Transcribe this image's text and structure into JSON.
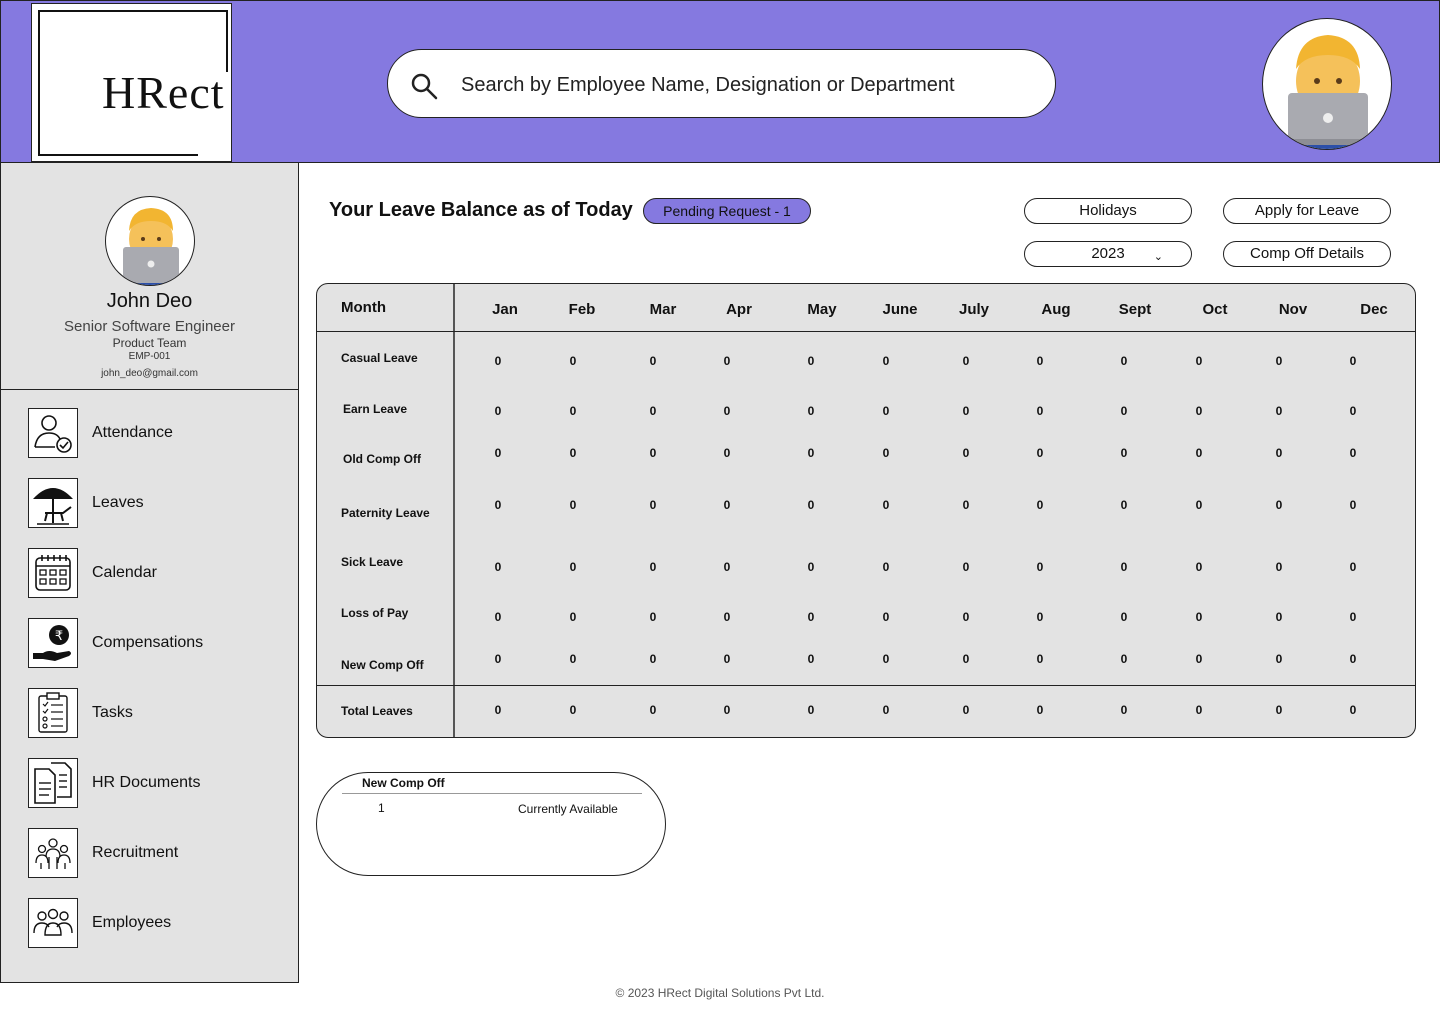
{
  "header": {
    "logo_text": "HRect",
    "search_placeholder": "Search by Employee Name, Designation or Department",
    "brand_color": "#8579e0"
  },
  "profile": {
    "name": "John Deo",
    "role": "Senior Software Engineer",
    "team": "Product Team",
    "emp_id": "EMP-001",
    "email": "john_deo@gmail.com"
  },
  "nav": [
    {
      "label": "Attendance",
      "icon": "user-check-icon"
    },
    {
      "label": "Leaves",
      "icon": "beach-umbrella-icon"
    },
    {
      "label": "Calendar",
      "icon": "calendar-icon"
    },
    {
      "label": "Compensations",
      "icon": "rupee-hand-icon"
    },
    {
      "label": "Tasks",
      "icon": "checklist-icon"
    },
    {
      "label": "HR Documents",
      "icon": "documents-icon"
    },
    {
      "label": "Recruitment",
      "icon": "recruitment-icon"
    },
    {
      "label": "Employees",
      "icon": "employees-icon"
    }
  ],
  "main": {
    "title": "Your Leave Balance as of Today",
    "pending": "Pending Request - 1",
    "holidays_label": "Holidays",
    "apply_label": "Apply for Leave",
    "year": "2023",
    "comp_off_label": "Comp Off Details"
  },
  "leave_table": {
    "month_header": "Month",
    "months": [
      "Jan",
      "Feb",
      "Mar",
      "Apr",
      "May",
      "June",
      "July",
      "Aug",
      "Sept",
      "Oct",
      "Nov",
      "Dec"
    ],
    "rows": [
      {
        "label": "Casual Leave",
        "values": [
          "0",
          "0",
          "0",
          "0",
          "0",
          "0",
          "0",
          "0",
          "0",
          "0",
          "0",
          "0"
        ]
      },
      {
        "label": "Earn Leave",
        "values": [
          "0",
          "0",
          "0",
          "0",
          "0",
          "0",
          "0",
          "0",
          "0",
          "0",
          "0",
          "0"
        ]
      },
      {
        "label": "Old Comp Off",
        "values": [
          "0",
          "0",
          "0",
          "0",
          "0",
          "0",
          "0",
          "0",
          "0",
          "0",
          "0",
          "0"
        ]
      },
      {
        "label": "Paternity Leave",
        "values": [
          "0",
          "0",
          "0",
          "0",
          "0",
          "0",
          "0",
          "0",
          "0",
          "0",
          "0",
          "0"
        ]
      },
      {
        "label": "Sick Leave",
        "values": [
          "0",
          "0",
          "0",
          "0",
          "0",
          "0",
          "0",
          "0",
          "0",
          "0",
          "0",
          "0"
        ]
      },
      {
        "label": "Loss of Pay",
        "values": [
          "0",
          "0",
          "0",
          "0",
          "0",
          "0",
          "0",
          "0",
          "0",
          "0",
          "0",
          "0"
        ]
      },
      {
        "label": "New Comp Off",
        "values": [
          "0",
          "0",
          "0",
          "0",
          "0",
          "0",
          "0",
          "0",
          "0",
          "0",
          "0",
          "0"
        ]
      }
    ],
    "total": {
      "label": "Total Leaves",
      "values": [
        "0",
        "0",
        "0",
        "0",
        "0",
        "0",
        "0",
        "0",
        "0",
        "0",
        "0",
        "0"
      ]
    }
  },
  "comp_off": {
    "title": "New Comp Off",
    "count": "1",
    "status": "Currently Available"
  },
  "footer": "© 2023 HRect Digital Solutions Pvt Ltd."
}
